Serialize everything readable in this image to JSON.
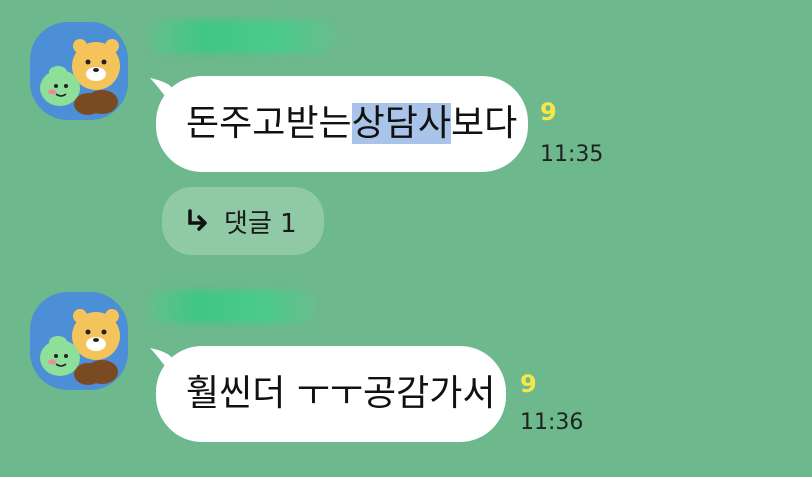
{
  "chat": {
    "messages": [
      {
        "sender_name": "",
        "text_before": "돈주고받는",
        "text_highlight": "상담사",
        "text_after": "보다",
        "unread_count": "9",
        "time": "11:35",
        "reply_label": "댓글 1"
      },
      {
        "sender_name": "",
        "text": "훨씬더 ㅜㅜ공감가서",
        "unread_count": "9",
        "time": "11:36"
      }
    ]
  },
  "colors": {
    "background": "#6db88c",
    "bubble": "#ffffff",
    "unread": "#f7e84a",
    "highlight": "#a9c4e8",
    "avatar_bg": "#4c8fd6"
  }
}
